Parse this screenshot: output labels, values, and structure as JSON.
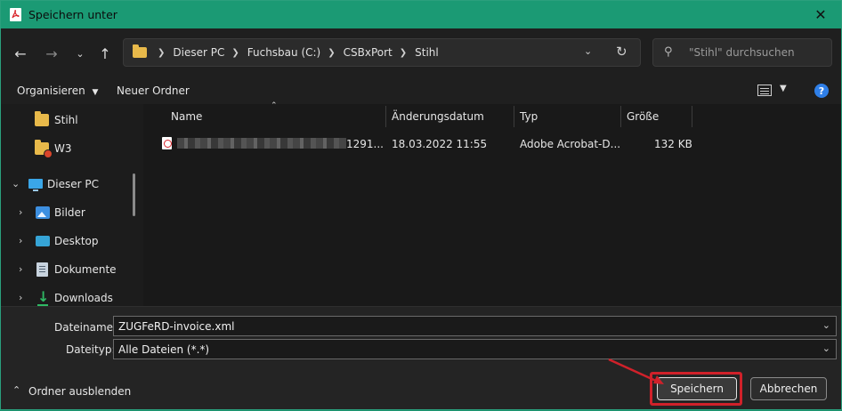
{
  "window": {
    "title": "Speichern unter",
    "close_icon": "close-icon"
  },
  "navigation": {
    "back_icon": "arrow-left-icon",
    "forward_icon": "arrow-right-icon",
    "recent_icon": "chevron-down-icon",
    "up_icon": "arrow-up-icon",
    "breadcrumbs": [
      "Dieser PC",
      "Fuchsbau (C:)",
      "CSBxPort",
      "Stihl"
    ],
    "search_placeholder": "\"Stihl\" durchsuchen"
  },
  "commandbar": {
    "organize_label": "Organisieren",
    "new_folder_label": "Neuer Ordner",
    "help_label": "?"
  },
  "navpane": {
    "items": [
      {
        "label": "Stihl",
        "icon": "folder-icon"
      },
      {
        "label": "W3",
        "icon": "folder-warning-icon"
      },
      {
        "label": "Dieser PC",
        "icon": "computer-icon"
      },
      {
        "label": "Bilder",
        "icon": "pictures-icon"
      },
      {
        "label": "Desktop",
        "icon": "desktop-icon"
      },
      {
        "label": "Dokumente",
        "icon": "documents-icon"
      },
      {
        "label": "Downloads",
        "icon": "downloads-icon"
      }
    ]
  },
  "filelist": {
    "columns": [
      "Name",
      "Änderungsdatum",
      "Typ",
      "Größe"
    ],
    "rows": [
      {
        "name_suffix": "1291...",
        "date": "18.03.2022 11:55",
        "type": "Adobe Acrobat-D...",
        "size": "132 KB"
      }
    ]
  },
  "form": {
    "filename_label": "Dateiname:",
    "filename_value": "ZUGFeRD-invoice.xml",
    "filetype_label": "Dateityp:",
    "filetype_value": "Alle Dateien (*.*)"
  },
  "footer": {
    "hide_folders_label": "Ordner ausblenden",
    "save_label": "Speichern",
    "cancel_label": "Abbrechen"
  },
  "colors": {
    "titlebar": "#1b9a74",
    "annotation": "#d0212a"
  }
}
